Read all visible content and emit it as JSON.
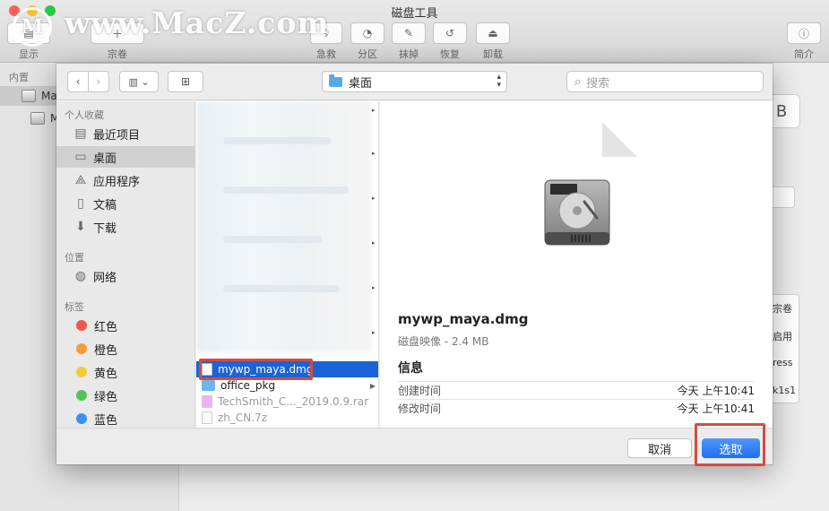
{
  "window": {
    "title": "磁盘工具",
    "toolbar": [
      "显示",
      "宗卷",
      "急救",
      "分区",
      "抹掉",
      "恢复",
      "卸载",
      "简介"
    ]
  },
  "watermark": {
    "logo": "M",
    "text": "www.MacZ.com"
  },
  "bg_sidebar": {
    "section": "内置",
    "items": [
      "Ma",
      "Ma"
    ]
  },
  "bg_right": {
    "size_text": "B",
    "labels": [
      "宗卷",
      "启用",
      "ress",
      "k1s1"
    ]
  },
  "dialog": {
    "path": "桌面",
    "search_placeholder": "搜索",
    "sidebar": {
      "favorites_header": "个人收藏",
      "favorites": [
        {
          "label": "最近项目",
          "icon": "recents-icon"
        },
        {
          "label": "桌面",
          "icon": "desktop-icon",
          "selected": true
        },
        {
          "label": "应用程序",
          "icon": "applications-icon"
        },
        {
          "label": "文稿",
          "icon": "documents-icon"
        },
        {
          "label": "下载",
          "icon": "downloads-icon"
        }
      ],
      "locations_header": "位置",
      "locations": [
        {
          "label": "网络",
          "icon": "network-icon"
        }
      ],
      "tags_header": "标签",
      "tags": [
        {
          "label": "红色",
          "color": "#f0574f"
        },
        {
          "label": "橙色",
          "color": "#f59b3a"
        },
        {
          "label": "黄色",
          "color": "#f4cb3a"
        },
        {
          "label": "绿色",
          "color": "#56c25a"
        },
        {
          "label": "蓝色",
          "color": "#3d8ff2"
        }
      ]
    },
    "files": [
      {
        "name": "mywp_maya.dmg",
        "type": "dmg",
        "selected": true
      },
      {
        "name": "office_pkg",
        "type": "folder"
      },
      {
        "name": "TechSmith_C..._2019.0.9.rar",
        "type": "rar",
        "dim": true
      },
      {
        "name": "zh_CN.7z",
        "type": "7z",
        "dim": true
      }
    ],
    "preview": {
      "filename": "mywp_maya.dmg",
      "subtitle": "磁盘映像 - 2.4 MB",
      "info_header": "信息",
      "rows": [
        {
          "label": "创建时间",
          "value": "今天 上午10:41"
        },
        {
          "label": "修改时间",
          "value": "今天 上午10:41"
        }
      ]
    },
    "buttons": {
      "cancel": "取消",
      "choose": "选取"
    }
  }
}
